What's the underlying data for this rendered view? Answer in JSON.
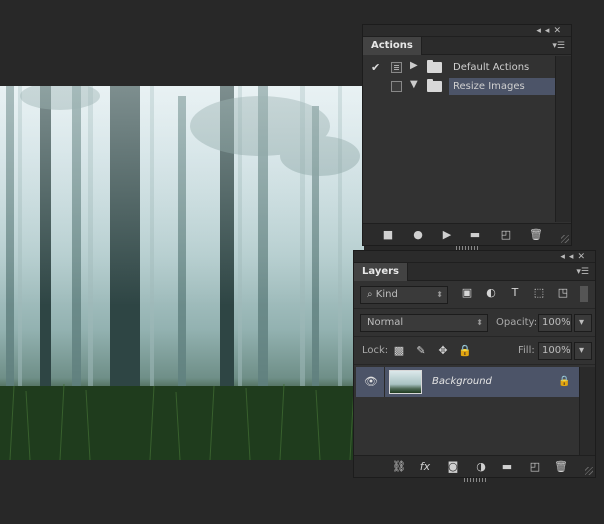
{
  "actions_panel": {
    "tab_label": "Actions",
    "collapse_icon": "double-chevron-left-icon",
    "close_icon": "close-icon",
    "menu_icon": "panel-menu-icon",
    "items": [
      {
        "label": "Default Actions",
        "checked": true,
        "expanded": false,
        "selected": false
      },
      {
        "label": "Resize Images",
        "checked": false,
        "expanded": true,
        "selected": true
      }
    ],
    "bottom_buttons": [
      "stop-icon",
      "record-icon",
      "play-icon",
      "new-set-folder-icon",
      "new-action-icon",
      "trash-icon"
    ]
  },
  "layers_panel": {
    "tab_label": "Layers",
    "filter": {
      "value": "Kind"
    },
    "filter_icons": [
      "pixel-filter-icon",
      "adjustment-filter-icon",
      "type-filter-icon",
      "shape-filter-icon",
      "smart-object-filter-icon"
    ],
    "blend_mode": "Normal",
    "opacity_label": "Opacity:",
    "opacity_value": "100%",
    "lock_label": "Lock:",
    "fill_label": "Fill:",
    "fill_value": "100%",
    "layers": [
      {
        "name": "Background",
        "visible": true,
        "locked": true
      }
    ],
    "bottom_buttons": [
      "link-icon",
      "fx-icon",
      "mask-icon",
      "adjustment-icon",
      "group-folder-icon",
      "new-layer-icon",
      "trash-icon"
    ]
  },
  "colors": {
    "workspace_bg": "#282828",
    "panel_bg": "#323232",
    "selection": "#4c5468"
  }
}
